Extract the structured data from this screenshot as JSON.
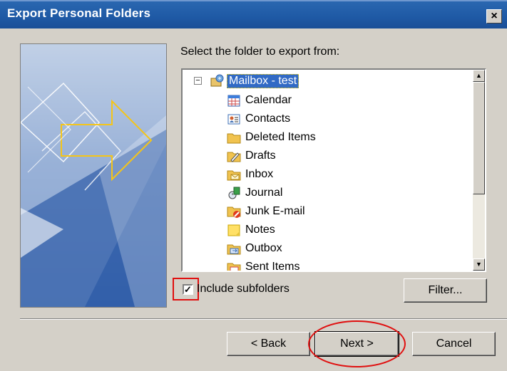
{
  "dialog": {
    "title": "Export Personal Folders",
    "close_glyph": "×",
    "prompt": "Select the folder to export from:",
    "tree": {
      "root": {
        "label": "Mailbox - test",
        "expander": "−",
        "icon": "mailbox-icon",
        "selected": true
      },
      "items": [
        {
          "label": "Calendar",
          "icon": "calendar-icon"
        },
        {
          "label": "Contacts",
          "icon": "contacts-icon"
        },
        {
          "label": "Deleted Items",
          "icon": "folder-icon"
        },
        {
          "label": "Drafts",
          "icon": "drafts-icon"
        },
        {
          "label": "Inbox",
          "icon": "inbox-icon"
        },
        {
          "label": "Journal",
          "icon": "journal-icon"
        },
        {
          "label": "Junk E-mail",
          "icon": "junk-icon"
        },
        {
          "label": "Notes",
          "icon": "notes-icon"
        },
        {
          "label": "Outbox",
          "icon": "outbox-icon"
        },
        {
          "label": "Sent Items",
          "icon": "sent-icon"
        }
      ]
    },
    "include_subfolders": {
      "label": "Include subfolders",
      "checked": true
    },
    "buttons": {
      "filter": "Filter...",
      "back": "< Back",
      "next": "Next >",
      "cancel": "Cancel"
    },
    "colors": {
      "title_bar": "#1f5aa6",
      "face": "#d4d0c8",
      "selection": "#316ac5",
      "annotation": "#e01010"
    }
  }
}
